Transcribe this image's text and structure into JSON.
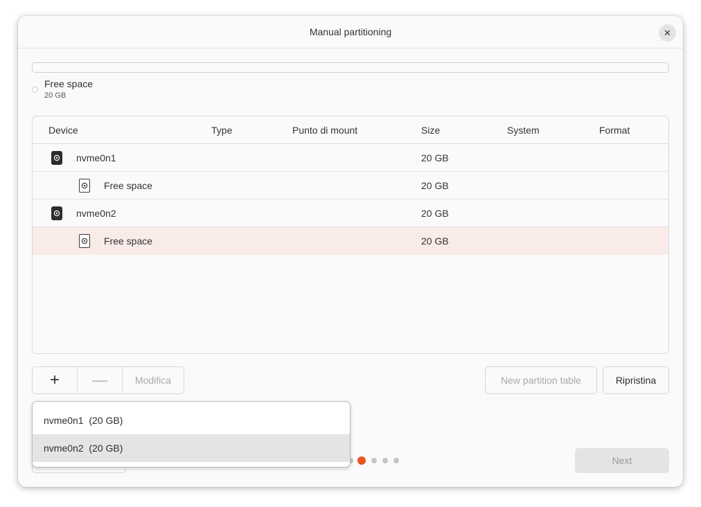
{
  "window": {
    "title": "Manual partitioning"
  },
  "legend": {
    "label": "Free space",
    "size": "20 GB"
  },
  "table": {
    "columns": [
      "Device",
      "Type",
      "Punto di mount",
      "Size",
      "System",
      "Format"
    ],
    "rows": [
      {
        "device": "nvme0n1",
        "size": "20 GB",
        "kind": "disk"
      },
      {
        "device": "Free space",
        "size": "20 GB",
        "kind": "partition"
      },
      {
        "device": "nvme0n2",
        "size": "20 GB",
        "kind": "disk"
      },
      {
        "device": "Free space",
        "size": "20 GB",
        "kind": "partition",
        "selected": true
      }
    ]
  },
  "toolbar": {
    "add_label": "+",
    "remove_label": "—",
    "modify_label": "Modifica",
    "new_table_label": "New partition table",
    "reset_label": "Ripristina"
  },
  "dropdown": {
    "options": [
      "nvme0n1  (20 GB)",
      "nvme0n2  (20 GB)"
    ]
  },
  "footer": {
    "next_label": "Next",
    "pages_total": 5,
    "current_page": 2
  },
  "icons": {
    "close": "close-icon",
    "disk": "drive-icon",
    "partition": "partition-icon"
  },
  "colors": {
    "accent": "#e95420",
    "selected_row": "#f8ebe8"
  }
}
